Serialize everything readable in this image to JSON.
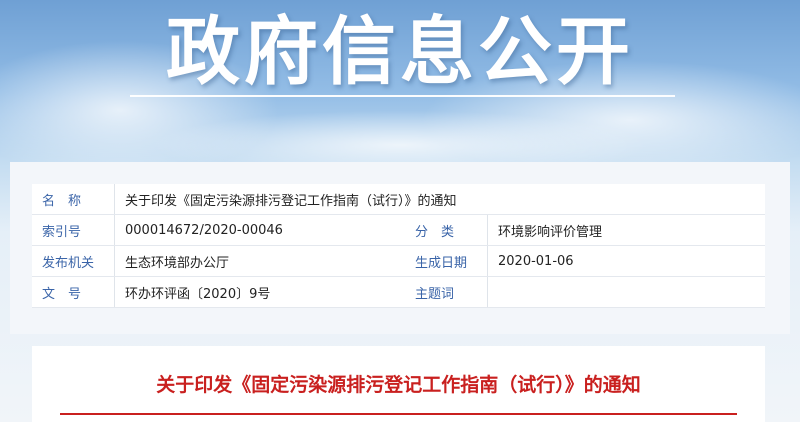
{
  "banner": {
    "title": "政府信息公开"
  },
  "info": {
    "name_label": "名　称",
    "name_value": "关于印发《固定污染源排污登记工作指南（试行）》的通知",
    "index_label": "索引号",
    "index_value": "000014672/2020-00046",
    "category_label": "分　类",
    "category_value": "环境影响评价管理",
    "publisher_label": "发布机关",
    "publisher_value": "生态环境部办公厅",
    "date_label": "生成日期",
    "date_value": "2020-01-06",
    "docno_label": "文　号",
    "docno_value": "环办环评函〔2020〕9号",
    "subject_label": "主题词",
    "subject_value": ""
  },
  "document": {
    "title": "关于印发《固定污染源排污登记工作指南（试行）》的通知"
  },
  "colors": {
    "label_blue": "#3a64a8",
    "title_red": "#c9201f"
  }
}
